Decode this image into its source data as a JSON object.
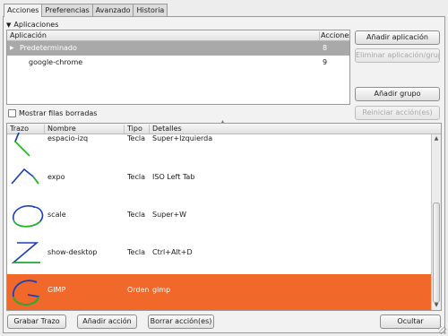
{
  "tabs": [
    "Acciones",
    "Preferencias",
    "Avanzado",
    "Historia"
  ],
  "expander": {
    "label": "Aplicaciones"
  },
  "apps_table": {
    "col_app": "Aplicación",
    "col_actions": "Acciones",
    "rows": [
      {
        "name": "Predeterminado",
        "count": "8"
      },
      {
        "name": "google-chrome",
        "count": "9"
      }
    ]
  },
  "right_buttons": {
    "add_app": "Añadir aplicación",
    "remove_app": "Eliminar aplicación/grupo",
    "add_group": "Añadir grupo",
    "reset_action": "Reiniciar acción(es)"
  },
  "show_deleted": "Mostrar filas borradas",
  "actions_table": {
    "col_stroke": "Trazo",
    "col_name": "Nombre",
    "col_type": "Tipo",
    "col_details": "Detalles",
    "rows": [
      {
        "name": "espacio-izq",
        "type": "Tecla",
        "details": "Super+Izquierda"
      },
      {
        "name": "expo",
        "type": "Tecla",
        "details": "ISO Left Tab"
      },
      {
        "name": "scale",
        "type": "Tecla",
        "details": "Super+W"
      },
      {
        "name": "show-desktop",
        "type": "Tecla",
        "details": "Ctrl+Alt+D"
      },
      {
        "name": "GIMP",
        "type": "Orden",
        "details": "gimp"
      }
    ]
  },
  "bottom_buttons": {
    "record": "Grabar Trazo",
    "add_action": "Añadir acción",
    "delete_action": "Borrar acción(es)",
    "hide": "Ocultar"
  },
  "colors": {
    "selection": "#f0692a",
    "stroke_blue": "#1a3fbf",
    "stroke_green": "#1fb81f"
  }
}
